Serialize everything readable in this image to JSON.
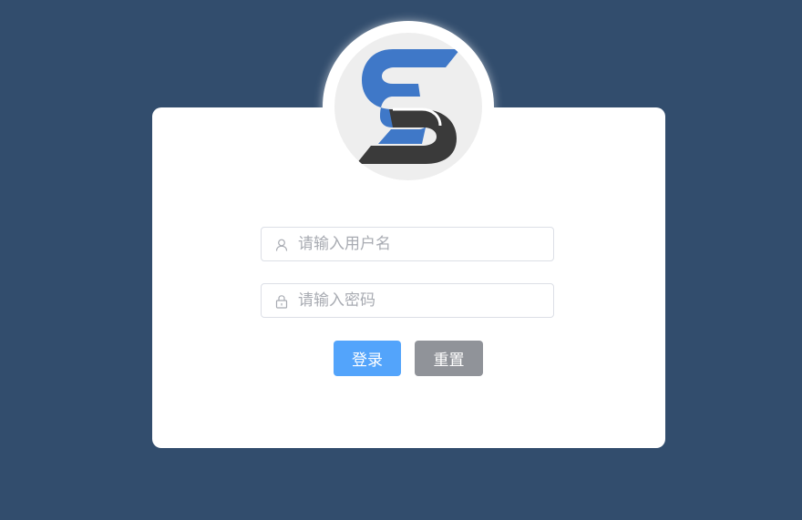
{
  "logo": {
    "icon": "s-logo-icon",
    "colors": {
      "blue": "#3f78c8",
      "dark": "#3a3a3a",
      "background": "#eeeeee"
    }
  },
  "form": {
    "username": {
      "placeholder": "请输入用户名",
      "value": "",
      "icon": "user-icon"
    },
    "password": {
      "placeholder": "请输入密码",
      "value": "",
      "icon": "lock-icon"
    }
  },
  "buttons": {
    "login_label": "登录",
    "reset_label": "重置"
  },
  "colors": {
    "page_background": "#324d6d",
    "card": "#ffffff",
    "primary": "#53a4fb",
    "info": "#909399"
  }
}
